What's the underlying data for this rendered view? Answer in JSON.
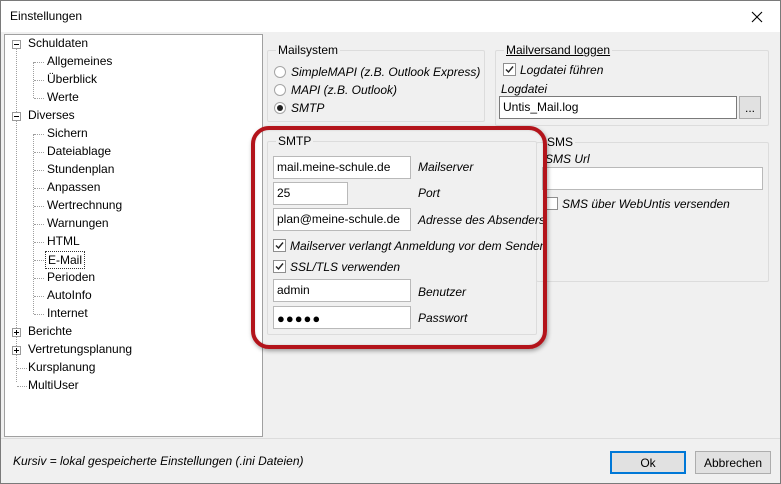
{
  "window": {
    "title": "Einstellungen"
  },
  "tree": {
    "items": [
      {
        "label": "Schuldaten",
        "level": 0,
        "expander": "minus"
      },
      {
        "label": "Allgemeines",
        "level": 1
      },
      {
        "label": "Überblick",
        "level": 1
      },
      {
        "label": "Werte",
        "level": 1
      },
      {
        "label": "Diverses",
        "level": 0,
        "expander": "minus"
      },
      {
        "label": "Sichern",
        "level": 1
      },
      {
        "label": "Dateiablage",
        "level": 1
      },
      {
        "label": "Stundenplan",
        "level": 1
      },
      {
        "label": "Anpassen",
        "level": 1
      },
      {
        "label": "Wertrechnung",
        "level": 1
      },
      {
        "label": "Warnungen",
        "level": 1
      },
      {
        "label": "HTML",
        "level": 1
      },
      {
        "label": "E-Mail",
        "level": 1,
        "selected": true
      },
      {
        "label": "Perioden",
        "level": 1
      },
      {
        "label": "AutoInfo",
        "level": 1
      },
      {
        "label": "Internet",
        "level": 1
      },
      {
        "label": "Berichte",
        "level": 0,
        "expander": "plus"
      },
      {
        "label": "Vertretungsplanung",
        "level": 0,
        "expander": "plus"
      },
      {
        "label": "Kursplanung",
        "level": 0
      },
      {
        "label": "MultiUser",
        "level": 0
      }
    ]
  },
  "mailsystem": {
    "title": "Mailsystem",
    "options": [
      "SimpleMAPI (z.B. Outlook Express)",
      "MAPI (z.B. Outlook)",
      "SMTP"
    ],
    "selected": "SMTP"
  },
  "logging": {
    "title": "Mailversand loggen",
    "checkbox_label": "Logdatei führen",
    "checked": true,
    "file_label": "Logdatei",
    "file_value": "Untis_Mail.log",
    "browse_label": "..."
  },
  "smtp": {
    "title": "SMTP",
    "server_value": "mail.meine-schule.de",
    "server_label": "Mailserver",
    "port_value": "25",
    "port_label": "Port",
    "sender_value": "plan@meine-schule.de",
    "sender_label": "Adresse des Absenders",
    "auth_label": "Mailserver verlangt Anmeldung vor dem Senden",
    "auth_checked": true,
    "ssl_label": "SSL/TLS verwenden",
    "ssl_checked": true,
    "user_value": "admin",
    "user_label": "Benutzer",
    "password_value": "●●●●●",
    "password_label": "Passwort"
  },
  "sms": {
    "title": "SMS",
    "url_label": "SMS Url",
    "url_value": "",
    "webuntis_label": "SMS über WebUntis versenden",
    "webuntis_checked": false
  },
  "footer": {
    "note": "Kursiv = lokal gespeicherte Einstellungen (.ini Dateien)",
    "ok_label": "Ok",
    "cancel_label": "Abbrechen"
  },
  "colors": {
    "highlight": "#b3141b",
    "default_button_border": "#0078d7"
  }
}
